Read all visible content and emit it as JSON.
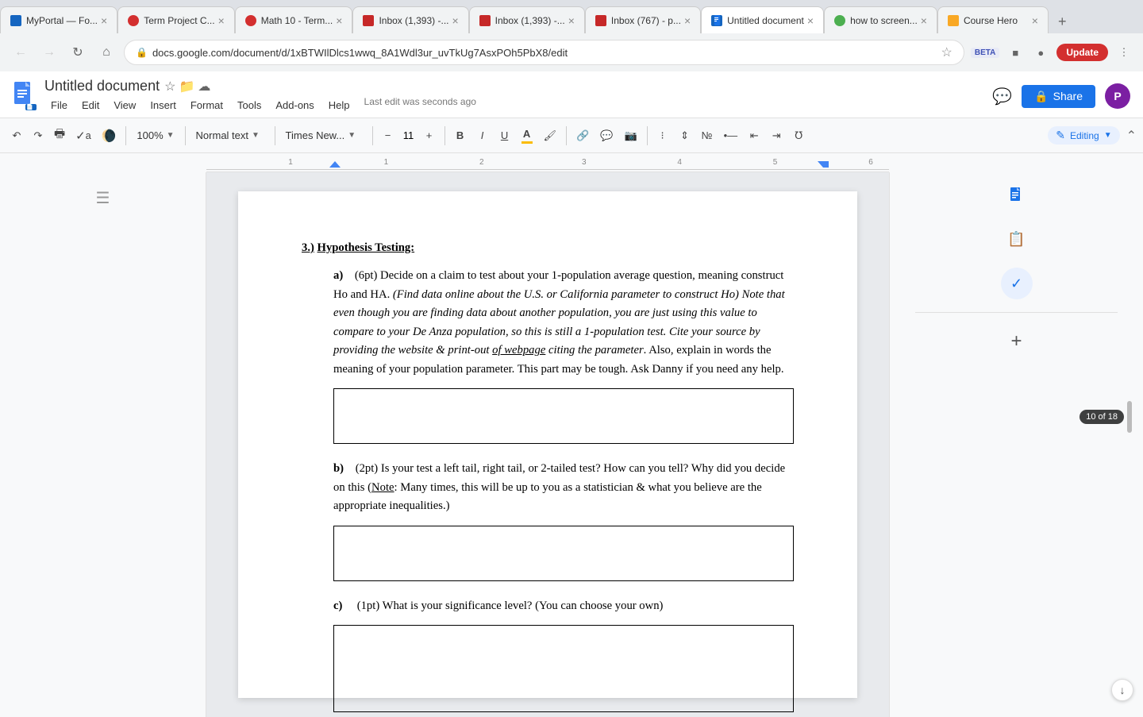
{
  "browser": {
    "tabs": [
      {
        "id": "tab1",
        "title": "MyPortal — Fo...",
        "favicon_color": "#1565c0",
        "active": false
      },
      {
        "id": "tab2",
        "title": "Term Project C...",
        "favicon_color": "#d32f2f",
        "active": false
      },
      {
        "id": "tab3",
        "title": "Math 10 - Term...",
        "favicon_color": "#d32f2f",
        "active": false
      },
      {
        "id": "tab4",
        "title": "Inbox (1,393) -...",
        "favicon_color": "#c62828",
        "active": false
      },
      {
        "id": "tab5",
        "title": "Inbox (1,393) -...",
        "favicon_color": "#c62828",
        "active": false
      },
      {
        "id": "tab6",
        "title": "Inbox (767) - p...",
        "favicon_color": "#c62828",
        "active": false
      },
      {
        "id": "tab7",
        "title": "Untitled docu...",
        "favicon_color": "#1565c0",
        "active": true
      },
      {
        "id": "tab8",
        "title": "how to screen...",
        "favicon_color": "#4caf50",
        "active": false
      },
      {
        "id": "tab9",
        "title": "Course Hero",
        "favicon_color": "#f9a825",
        "active": false
      }
    ],
    "url": "docs.google.com/document/d/1xBTWIlDlcs1wwq_8A1Wdl3ur_uvTkUg7AsxPOh5PbX8/edit",
    "update_label": "Update"
  },
  "docs": {
    "title": "Untitled document",
    "last_edit": "Last edit was seconds ago",
    "menu": [
      "File",
      "Edit",
      "View",
      "Insert",
      "Format",
      "Tools",
      "Add-ons",
      "Help"
    ],
    "toolbar": {
      "zoom": "100%",
      "style": "Normal text",
      "font": "Times New...",
      "font_size": "11",
      "bold_label": "B",
      "italic_label": "I",
      "underline_label": "U"
    },
    "share_label": "Share",
    "avatar_label": "P"
  },
  "document": {
    "section_number": "3.)",
    "section_title": "Hypothesis Testing:",
    "parts": [
      {
        "label": "a)",
        "points": "(6pt)",
        "text": "Decide on a claim to test about your 1-population average question, meaning construct Ho and HA.",
        "italic_text": "(Find data online about the U.S. or California parameter to construct Ho) Note that even though you are finding data about another population, you are just using this value to compare to your De Anza population, so this is still a 1-population test. Cite your source by providing the website & print-out",
        "underline_text": "of webpage",
        "text_after": "citing the parameter.",
        "extra_text": " Also, explain in words the meaning of your population parameter. This part may be tough. Ask Danny if you need any help.",
        "has_box": true
      },
      {
        "label": "b)",
        "points": "(2pt)",
        "text": "Is your test a left tail, right tail, or 2-tailed test? How can you tell? Why did you decide on this (",
        "note_text": "Note",
        "text_after_note": ": Many times, this will be up to you as a statistician & what you believe are the appropriate inequalities.)",
        "has_box": true
      },
      {
        "label": "c)",
        "points": "(1pt)",
        "text": "What is your significance level? (You can choose your own)",
        "has_box": true
      }
    ]
  },
  "right_sidebar": {
    "page_indicator": "10 of 18"
  }
}
